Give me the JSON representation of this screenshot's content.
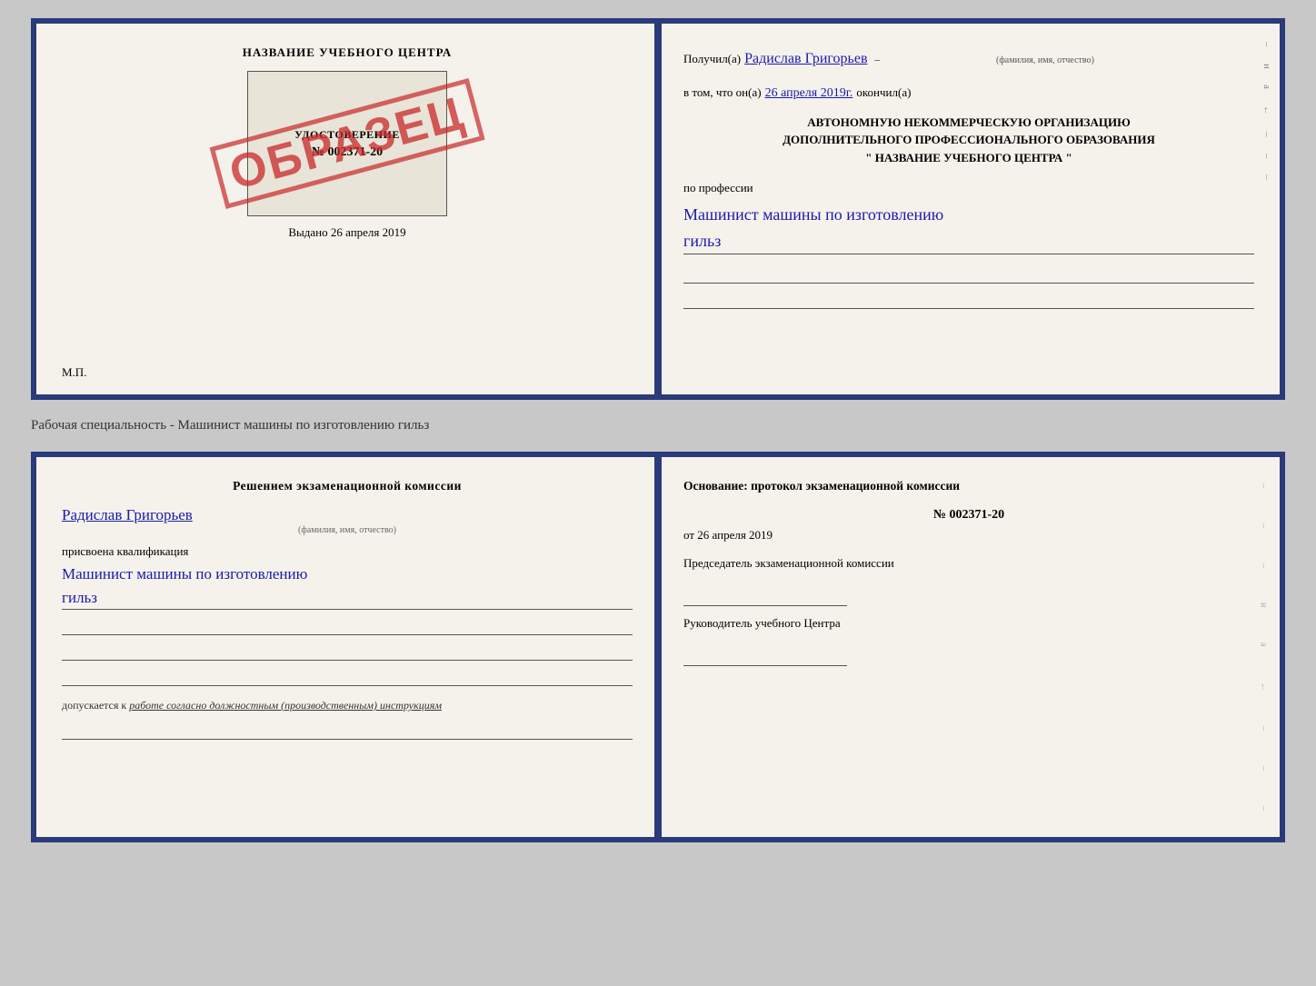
{
  "top_doc": {
    "left": {
      "header": "НАЗВАНИЕ УЧЕБНОГО ЦЕНТРА",
      "certificate_title": "УДОСТОВЕРЕНИЕ",
      "certificate_number": "№ 002371-20",
      "stamp": "ОБРАЗЕЦ",
      "vydano_label": "Выдано",
      "vydano_date": "26 апреля 2019",
      "mp_label": "М.П."
    },
    "right": {
      "received_prefix": "Получил(а)",
      "recipient_name": "Радислав Григорьев",
      "fio_label": "(фамилия, имя, отчество)",
      "date_prefix": "в том, что он(а)",
      "date_value": "26 апреля 2019г.",
      "finished_suffix": "окончил(а)",
      "org_line1": "АВТОНОМНУЮ НЕКОММЕРЧЕСКУЮ ОРГАНИЗАЦИЮ",
      "org_line2": "ДОПОЛНИТЕЛЬНОГО ПРОФЕССИОНАЛЬНОГО ОБРАЗОВАНИЯ",
      "org_line3": "\" НАЗВАНИЕ УЧЕБНОГО ЦЕНТРА \"",
      "profession_prefix": "по профессии",
      "profession_name": "Машинист машины по изготовлению",
      "profession_name2": "гильз"
    }
  },
  "subtitle": "Рабочая специальность - Машинист машины по изготовлению гильз",
  "bottom_doc": {
    "left": {
      "section_title": "Решением экзаменационной комиссии",
      "person_name": "Радислав Григорьев",
      "name_label": "(фамилия, имя, отчество)",
      "assigned_label": "присвоена квалификация",
      "qualification": "Машинист машины по изготовлению",
      "qualification2": "гильз",
      "allowed_prefix": "допускается к",
      "allowed_text": "работе согласно должностным (производственным) инструкциям"
    },
    "right": {
      "section_title": "Основание: протокол экзаменационной комиссии",
      "protocol_number": "№ 002371-20",
      "date_prefix": "от",
      "date_value": "26 апреля 2019",
      "chairman_label": "Председатель экзаменационной комиссии",
      "director_label": "Руководитель учебного Центра"
    }
  }
}
